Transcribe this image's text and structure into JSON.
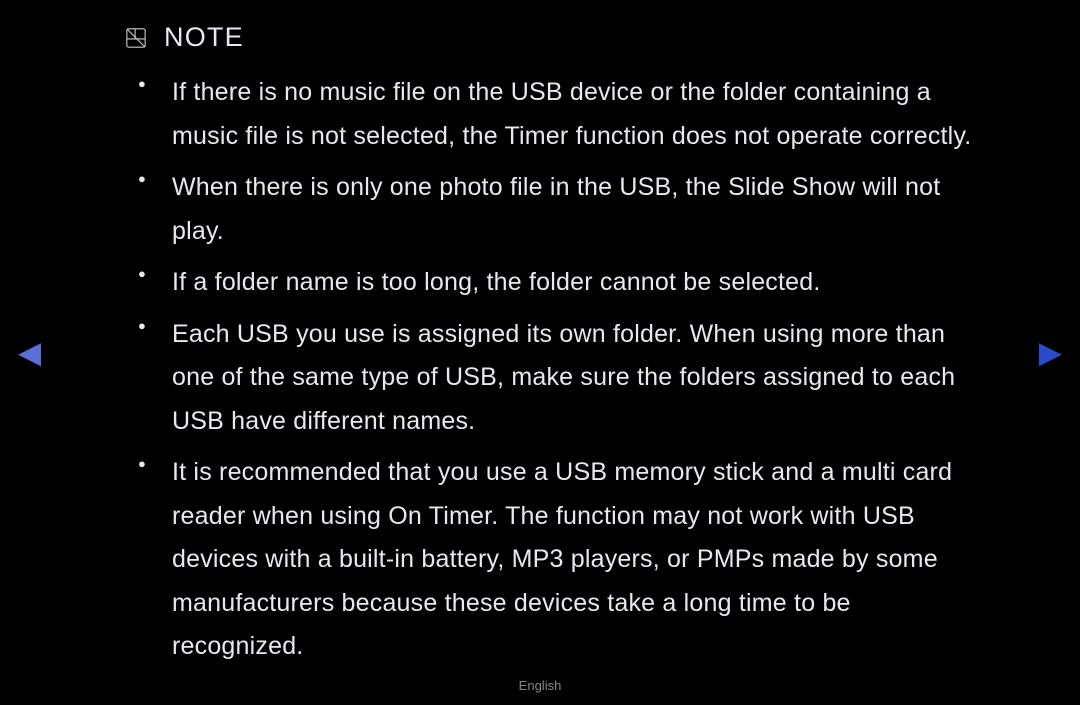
{
  "note": {
    "label": "NOTE",
    "items": [
      "If there is no music file on the USB device or the folder containing a music file is not selected, the Timer function does not operate correctly.",
      "When there is only one photo file in the USB, the Slide Show will not play.",
      "If a folder name is too long, the folder cannot be selected.",
      "Each USB you use is assigned its own folder. When using more than one of the same type of USB, make sure the folders assigned to each USB have different names.",
      "It is recommended that you use a USB memory stick and a multi card reader when using On Timer. The  function may not work with USB devices with a built-in battery, MP3 players, or PMPs made by some manufacturers because these devices take a long time to be recognized."
    ]
  },
  "footer": {
    "language": "English"
  },
  "nav": {
    "left": "◀",
    "right": "▶"
  }
}
